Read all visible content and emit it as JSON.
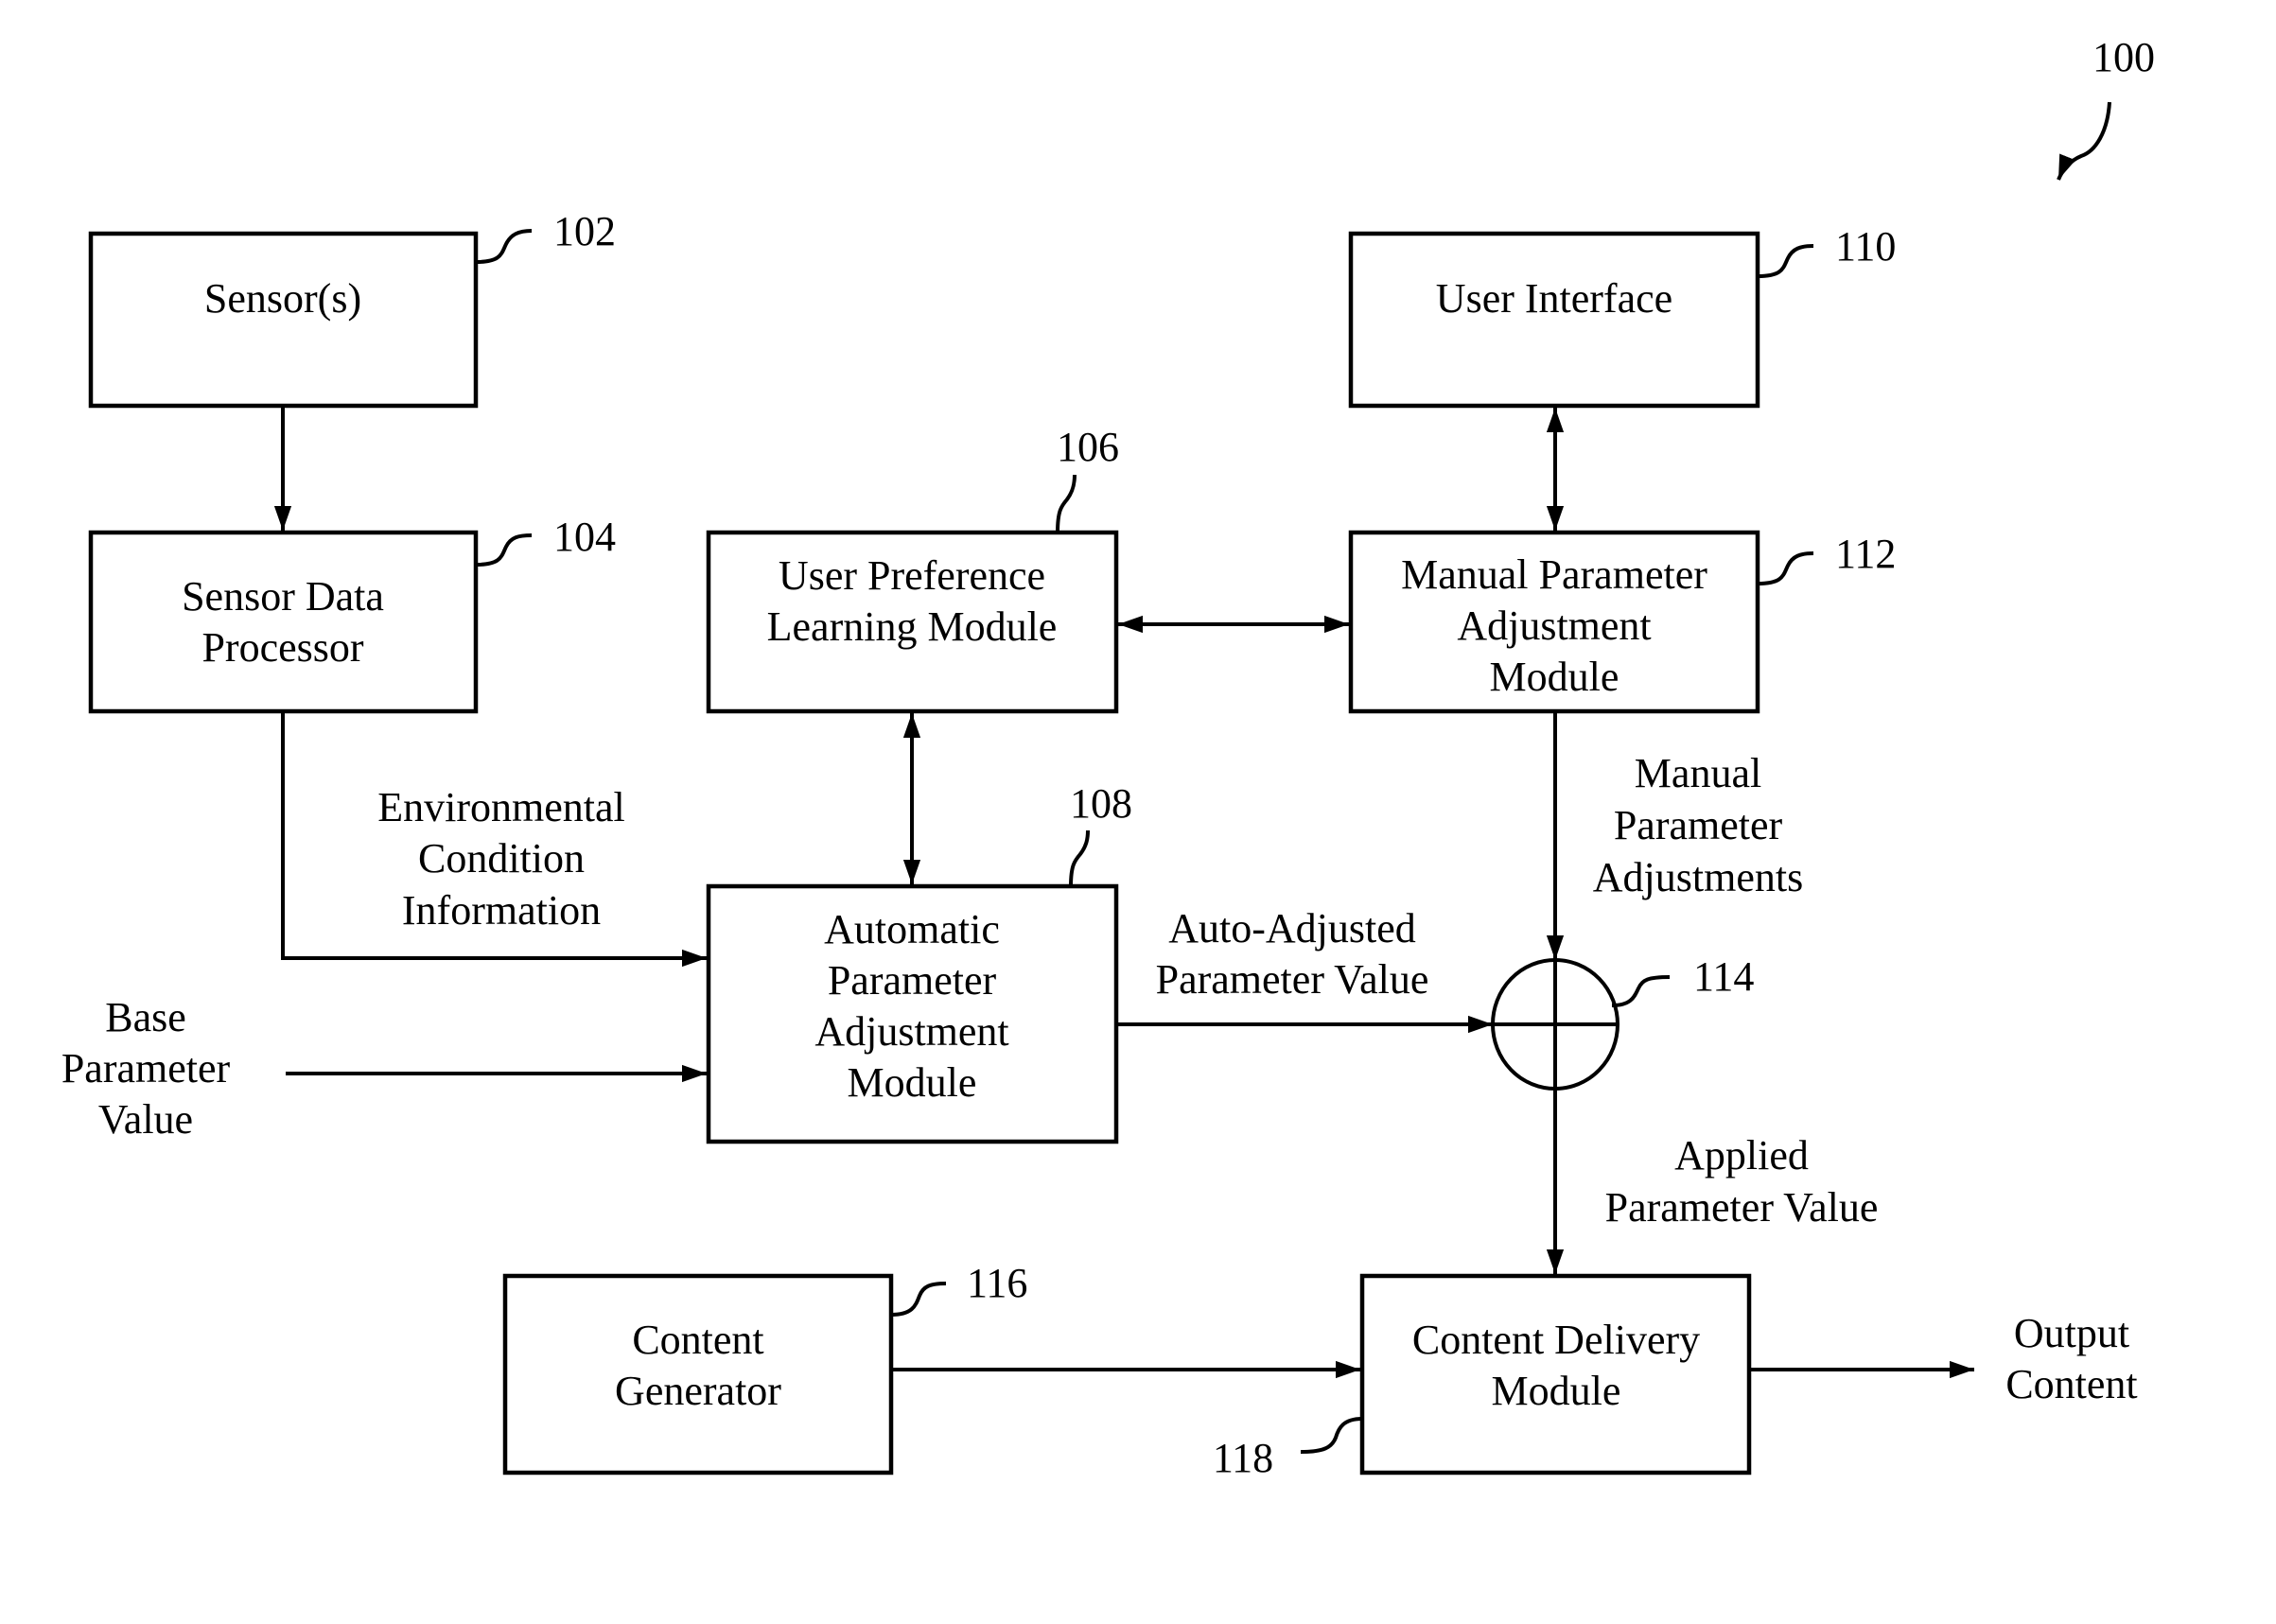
{
  "figure": {
    "reference": "100"
  },
  "blocks": {
    "sensors": {
      "ref": "102",
      "lines": [
        "Sensor(s)"
      ]
    },
    "sensor_data_processor": {
      "ref": "104",
      "lines": [
        "Sensor Data",
        "Processor"
      ]
    },
    "user_preference_learning": {
      "ref": "106",
      "lines": [
        "User Preference",
        "Learning Module"
      ]
    },
    "automatic_parameter_adjustment": {
      "ref": "108",
      "lines": [
        "Automatic",
        "Parameter",
        "Adjustment",
        "Module"
      ]
    },
    "user_interface": {
      "ref": "110",
      "lines": [
        "User Interface"
      ]
    },
    "manual_parameter_adjustment": {
      "ref": "112",
      "lines": [
        "Manual Parameter",
        "Adjustment",
        "Module"
      ]
    },
    "summing_junction": {
      "ref": "114"
    },
    "content_generator": {
      "ref": "116",
      "lines": [
        "Content",
        "Generator"
      ]
    },
    "content_delivery": {
      "ref": "118",
      "lines": [
        "Content Delivery",
        "Module"
      ]
    }
  },
  "signals": {
    "environmental_condition": [
      "Environmental",
      "Condition",
      "Information"
    ],
    "base_parameter_value": [
      "Base",
      "Parameter",
      "Value"
    ],
    "auto_adjusted_value": [
      "Auto-Adjusted",
      "Parameter Value"
    ],
    "manual_adjustments": [
      "Manual",
      "Parameter",
      "Adjustments"
    ],
    "applied_value": [
      "Applied",
      "Parameter Value"
    ],
    "output_content": [
      "Output",
      "Content"
    ]
  }
}
